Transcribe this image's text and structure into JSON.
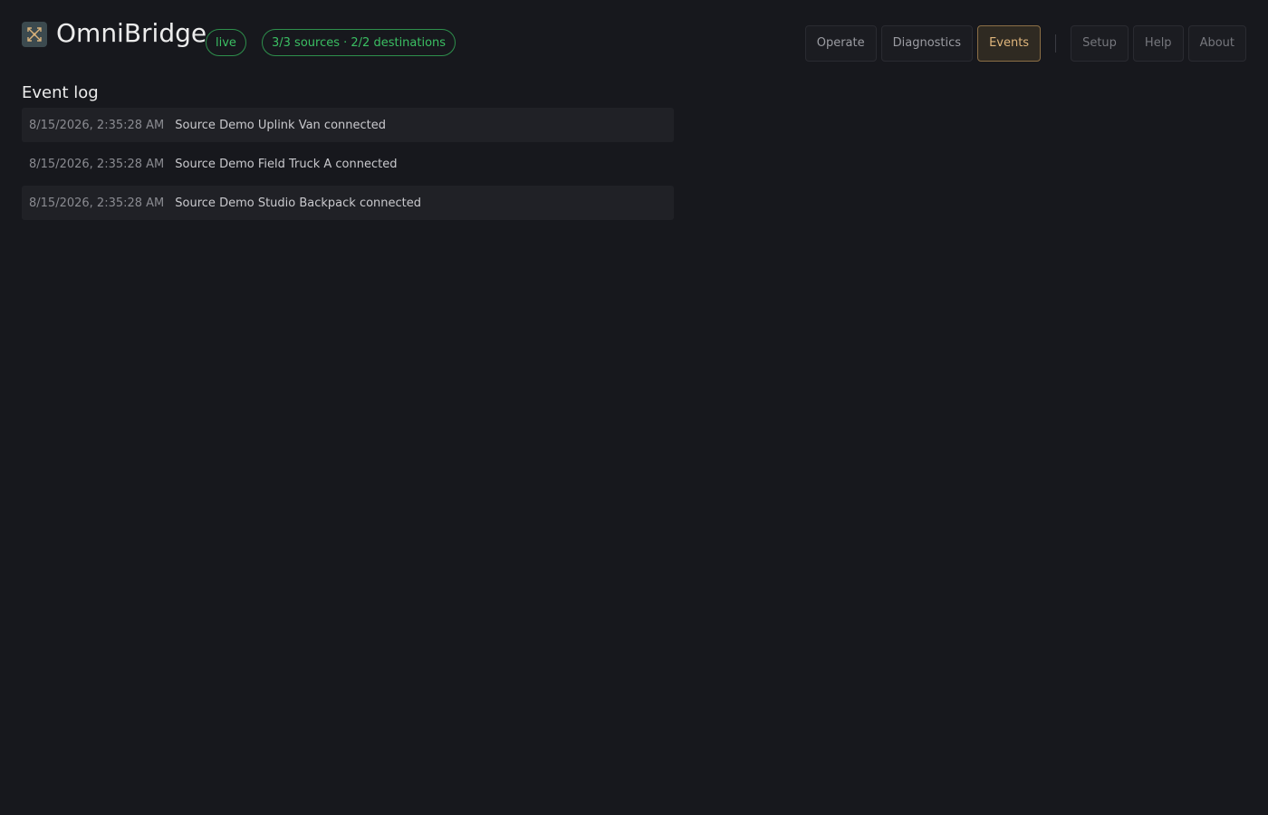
{
  "header": {
    "app_title": "OmniBridge",
    "logo_icon": "crossed-arrows-icon",
    "status_live": "live",
    "status_counts": "3/3 sources · 2/2 destinations",
    "accent_color": "#e0b67c",
    "status_color": "#3bbf63"
  },
  "nav": {
    "operate": "Operate",
    "diagnostics": "Diagnostics",
    "events": "Events",
    "setup": "Setup",
    "help": "Help",
    "about": "About",
    "active": "Events"
  },
  "main": {
    "section_title": "Event log",
    "events": [
      {
        "time": "8/15/2026, 2:35:28 AM",
        "message": "Source Demo Uplink Van connected"
      },
      {
        "time": "8/15/2026, 2:35:28 AM",
        "message": "Source Demo Field Truck A connected"
      },
      {
        "time": "8/15/2026, 2:35:28 AM",
        "message": "Source Demo Studio Backpack connected"
      }
    ]
  }
}
